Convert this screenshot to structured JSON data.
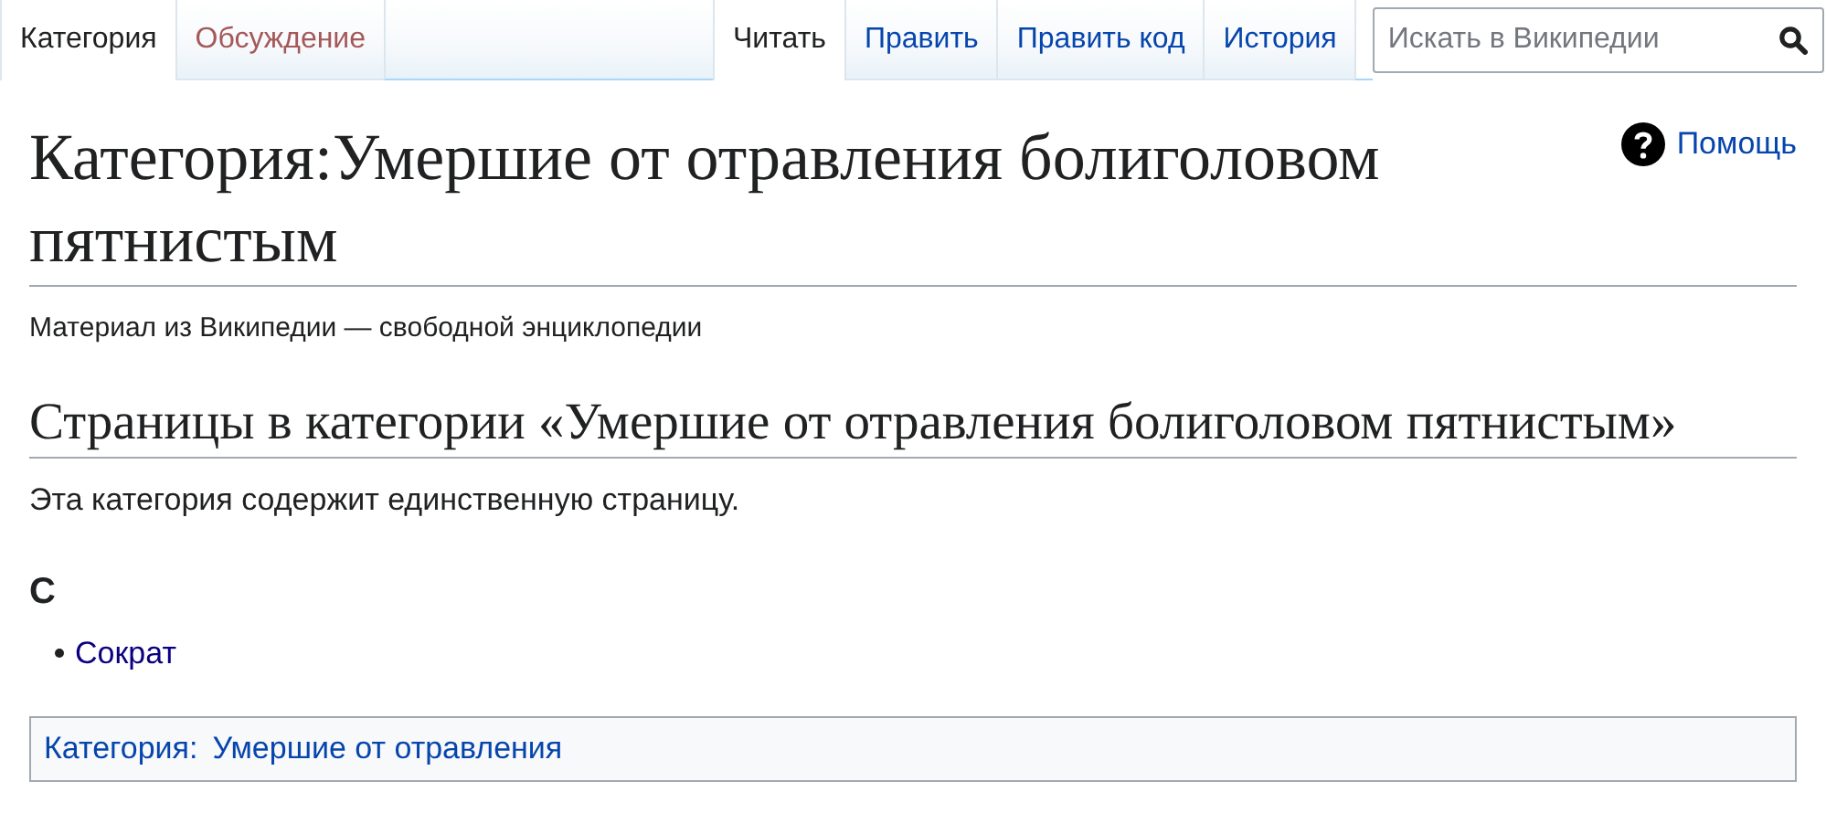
{
  "namespace_tabs": [
    {
      "label": "Категория",
      "selected": true,
      "missing": false
    },
    {
      "label": "Обсуждение",
      "selected": false,
      "missing": true
    }
  ],
  "view_tabs": [
    {
      "label": "Читать",
      "selected": true
    },
    {
      "label": "Править",
      "selected": false
    },
    {
      "label": "Править код",
      "selected": false
    },
    {
      "label": "История",
      "selected": false
    }
  ],
  "search": {
    "placeholder": "Искать в Википедии"
  },
  "help": {
    "label": "Помощь"
  },
  "title": "Категория:Умершие от отравления болиголовом пятнистым",
  "tagline": "Материал из Википедии — свободной энциклопедии",
  "section": {
    "heading": "Страницы в категории «Умершие от отравления болиголовом пятнистым»",
    "summary": "Эта категория содержит единственную страницу.",
    "groups": [
      {
        "letter": "С",
        "pages": [
          "Сократ"
        ]
      }
    ]
  },
  "catlinks": {
    "label": "Категория:",
    "items": [
      "Умершие от отравления"
    ]
  }
}
